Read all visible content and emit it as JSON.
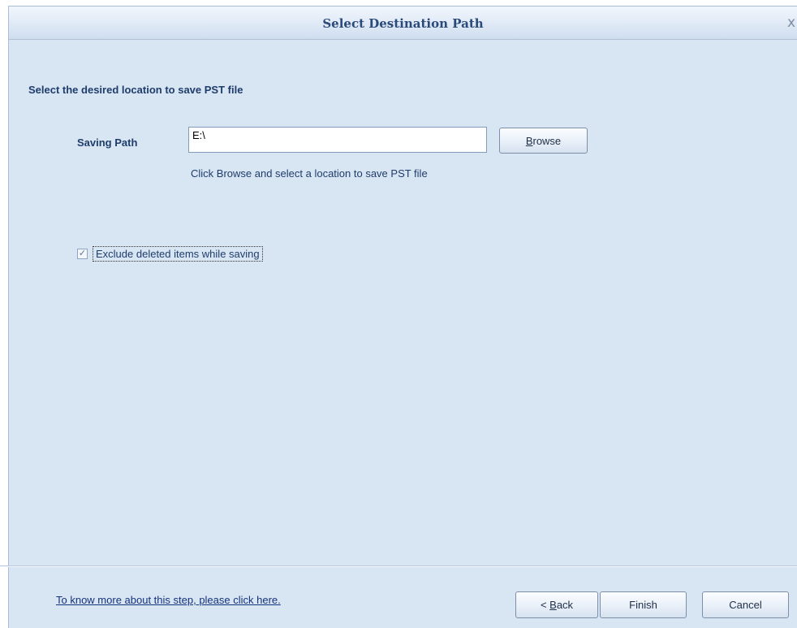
{
  "window": {
    "title": "Select Destination Path",
    "close_glyph": "x"
  },
  "main": {
    "heading": "Select the desired location to save PST file",
    "saving_path": {
      "label": "Saving Path",
      "value": "E:\\",
      "browse_label": "Browse",
      "browse_accel_before": "",
      "browse_accel": "B",
      "browse_accel_after": "rowse",
      "hint": "Click Browse and select a location to save PST file"
    },
    "exclude_deleted": {
      "label": "Exclude deleted items while saving",
      "checked": true,
      "check_glyph": "✓"
    }
  },
  "footer": {
    "help_link": "To know more about this step, please click here.",
    "back_prefix": "< ",
    "back_accel": "B",
    "back_rest": "ack",
    "finish_label": "Finish",
    "cancel_label": "Cancel"
  },
  "colors": {
    "background": "#d8e5f3",
    "title_text": "#2a4a7a",
    "label_text": "#1f3d6b",
    "link_text": "#15337a"
  }
}
